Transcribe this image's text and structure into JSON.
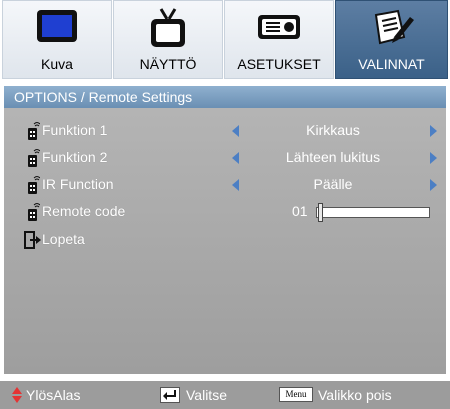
{
  "tabs": [
    {
      "label": "Kuva",
      "icon": "monitor-icon",
      "active": false
    },
    {
      "label": "NÄYTTÖ",
      "icon": "tv-icon",
      "active": false
    },
    {
      "label": "ASETUKSET",
      "icon": "projector-icon",
      "active": false
    },
    {
      "label": "VALINNAT",
      "icon": "notepad-pencil-icon",
      "active": true
    }
  ],
  "header": {
    "title": "OPTIONS / Remote Settings"
  },
  "rows": [
    {
      "label": "Funktion 1",
      "value": "Kirkkaus",
      "icon": "remote-control-icon"
    },
    {
      "label": "Funktion 2",
      "value": "Lähteen lukitus",
      "icon": "remote-control-icon"
    },
    {
      "label": "IR Function",
      "value": "Päälle",
      "icon": "remote-control-icon"
    },
    {
      "label": "Remote code",
      "value": "01",
      "icon": "remote-control-icon",
      "slider_fraction": 0.01
    },
    {
      "label": "Lopeta",
      "icon": "exit-icon"
    }
  ],
  "footer": {
    "nav_label": "YlösAlas",
    "select_label": "Valitse",
    "menu_key": "Menu",
    "menu_label": "Valikko pois"
  },
  "colors": {
    "accent_tab": "#3b6188",
    "header": "#6a8fb3",
    "panel": "#a8a8a8",
    "arrow": "#4c7fc4",
    "footer_nav_arrow": "#e53333"
  }
}
